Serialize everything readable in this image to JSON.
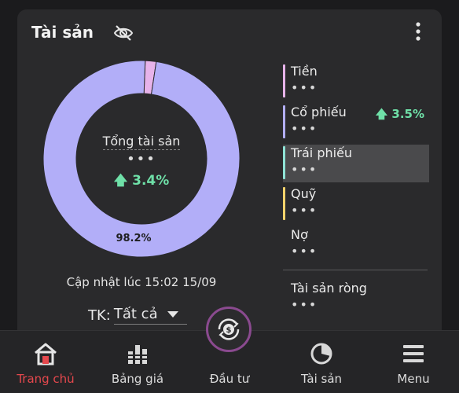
{
  "card": {
    "title": "Tài sản",
    "center_title": "Tổng tài sản",
    "center_value_hidden": "•••",
    "center_change": "3.4%",
    "slice_label": "98.2%",
    "updated": "Cập nhật lúc 15:02 15/09",
    "account_label": "TK:",
    "account_value": "Tất cả"
  },
  "chart_data": {
    "type": "pie",
    "categories": [
      "Tiền",
      "Cổ phiếu",
      "Trái phiếu",
      "Quỹ",
      "Nợ"
    ],
    "values": [
      1.8,
      98.2,
      0,
      0,
      0
    ],
    "colors": [
      "#e7b3ea",
      "#b2aef8",
      "#8fe3d6",
      "#f2d36b",
      "#9a9a9a"
    ],
    "annotations": [
      "98.2%"
    ]
  },
  "legend": {
    "items": [
      {
        "name": "Tiền",
        "value": "•••",
        "change": "",
        "color": "#e7b3ea"
      },
      {
        "name": "Cổ phiếu",
        "value": "•••",
        "change": "3.5%",
        "color": "#b2aef8"
      },
      {
        "name": "Trái phiếu",
        "value": "•••",
        "change": "",
        "color": "#8fe3d6"
      },
      {
        "name": "Quỹ",
        "value": "•••",
        "change": "",
        "color": "#f2d36b"
      },
      {
        "name": "Nợ",
        "value": "•••",
        "change": "",
        "color": "transparent"
      }
    ],
    "net_name": "Tài sản ròng",
    "net_value": "•••"
  },
  "tabs": [
    {
      "label": "Trang chủ",
      "icon": "home-icon",
      "active": true
    },
    {
      "label": "Bảng giá",
      "icon": "price-board-icon",
      "active": false
    },
    {
      "label": "Đầu tư",
      "icon": "invest-icon",
      "active": false
    },
    {
      "label": "Tài sản",
      "icon": "pie-chart-icon",
      "active": false
    },
    {
      "label": "Menu",
      "icon": "menu-icon",
      "active": false
    }
  ],
  "colors": {
    "accent_red": "#e5484d",
    "positive_green": "#6fe0a8",
    "invest_ring": "#8a4a8f"
  }
}
